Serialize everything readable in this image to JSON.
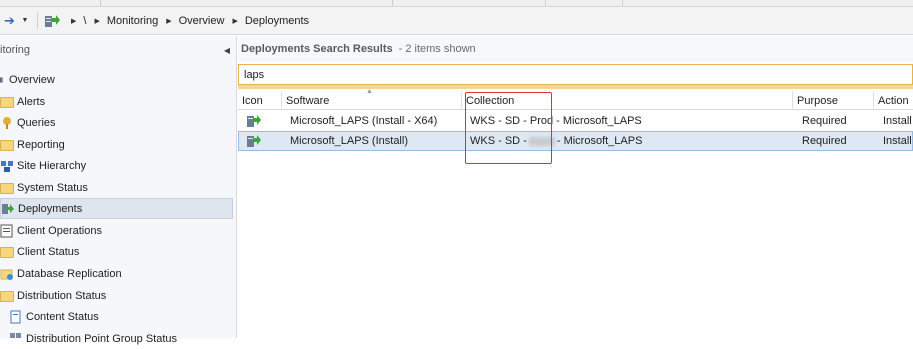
{
  "address_bar": {
    "breadcrumbs": [
      "\\",
      "Monitoring",
      "Overview",
      "Deployments"
    ]
  },
  "left_pane": {
    "header": "itoring",
    "items": [
      {
        "label": "Overview",
        "icon": "overview-icon"
      },
      {
        "label": "Alerts",
        "icon": "folder-icon"
      },
      {
        "label": "Queries",
        "icon": "queries-icon"
      },
      {
        "label": "Reporting",
        "icon": "folder-icon"
      },
      {
        "label": "Site Hierarchy",
        "icon": "site-hierarchy-icon"
      },
      {
        "label": "System Status",
        "icon": "folder-icon"
      },
      {
        "label": "Deployments",
        "icon": "deployments-icon"
      },
      {
        "label": "Client Operations",
        "icon": "client-operations-icon"
      },
      {
        "label": "Client Status",
        "icon": "folder-icon"
      },
      {
        "label": "Database Replication",
        "icon": "database-replication-icon"
      },
      {
        "label": "Distribution Status",
        "icon": "folder-icon"
      },
      {
        "label": "Content Status",
        "icon": "content-status-icon"
      },
      {
        "label": "Distribution Point Group Status",
        "icon": "group-status-icon"
      }
    ]
  },
  "results": {
    "title": "Deployments Search Results",
    "count": "-  2 items shown",
    "search_value": "laps",
    "columns": [
      "Icon",
      "Software",
      "Collection",
      "Purpose",
      "Action"
    ],
    "rows": [
      {
        "software": "Microsoft_LAPS (Install - X64)",
        "collection_prefix": "WKS - SD - Prod - Microsoft_LAPS",
        "purpose": "Required",
        "action": "Install"
      },
      {
        "software": "Microsoft_LAPS (Install)",
        "collection_prefix": "WKS - SD -",
        "collection_suffix": "- Microsoft_LAPS",
        "purpose": "Required",
        "action": "Install"
      }
    ]
  },
  "colors": {
    "highlight": "#e0302d",
    "selected_row": "#dde8f5",
    "search_border": "#e6b24a"
  }
}
